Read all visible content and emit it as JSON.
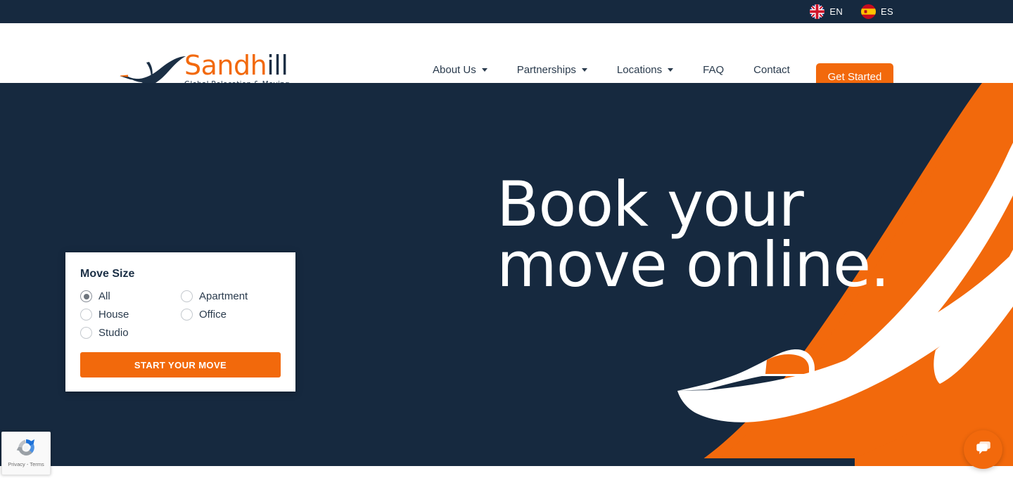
{
  "topbar": {
    "languages": [
      {
        "code": "EN",
        "flag_icon": "uk-flag-icon"
      },
      {
        "code": "ES",
        "flag_icon": "spain-flag-icon"
      }
    ]
  },
  "header": {
    "logo": {
      "brand_part1": "Sandh",
      "brand_part2": "ill",
      "tagline": "Global Relocation & Moving",
      "bird_icon": "crane-bird-logo-icon"
    },
    "nav": [
      {
        "label": "About Us",
        "has_dropdown": true
      },
      {
        "label": "Partnerships",
        "has_dropdown": true
      },
      {
        "label": "Locations",
        "has_dropdown": true
      },
      {
        "label": "FAQ",
        "has_dropdown": false
      },
      {
        "label": "Contact",
        "has_dropdown": false
      }
    ],
    "cta_label": "Get Started"
  },
  "hero": {
    "title": "Book your\nmove online.",
    "bg_color": "#16293f",
    "accent_color": "#f2690c",
    "bird_icon": "crane-bird-graphic"
  },
  "form_card": {
    "title": "Move Size",
    "options": [
      {
        "label": "All",
        "checked": true
      },
      {
        "label": "Apartment",
        "checked": false
      },
      {
        "label": "House",
        "checked": false
      },
      {
        "label": "Office",
        "checked": false
      },
      {
        "label": "Studio",
        "checked": false
      }
    ],
    "submit_label": "START YOUR MOVE"
  },
  "recaptcha": {
    "text": "Privacy - Terms",
    "icon": "recaptcha-icon"
  },
  "chat": {
    "icon": "chat-bubble-icon"
  }
}
